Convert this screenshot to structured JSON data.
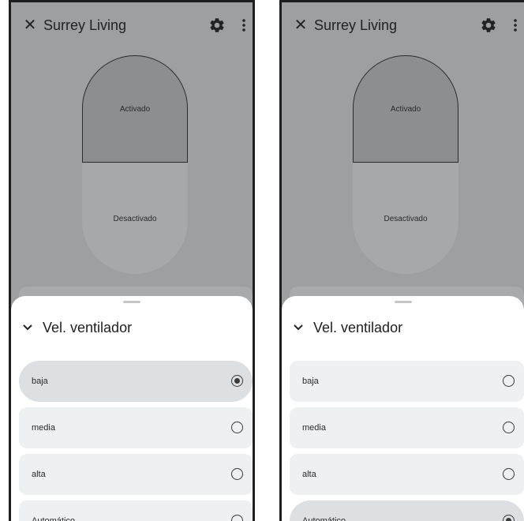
{
  "panels": [
    {
      "id": "left",
      "header": {
        "title": "Surrey Living"
      },
      "switch": {
        "on_label": "Activado",
        "off_label": "Desactivado"
      },
      "sheet": {
        "title": "Vel. ventilador"
      },
      "options": [
        {
          "label": "baja",
          "selected": true
        },
        {
          "label": "media",
          "selected": false
        },
        {
          "label": "alta",
          "selected": false
        },
        {
          "label": "Automático",
          "selected": false
        }
      ]
    },
    {
      "id": "right",
      "header": {
        "title": "Surrey Living"
      },
      "switch": {
        "on_label": "Activado",
        "off_label": "Desactivado"
      },
      "sheet": {
        "title": "Vel. ventilador"
      },
      "options": [
        {
          "label": "baja",
          "selected": false
        },
        {
          "label": "media",
          "selected": false
        },
        {
          "label": "alta",
          "selected": false
        },
        {
          "label": "Automático",
          "selected": true
        }
      ]
    }
  ],
  "icons": {
    "close": "close-icon",
    "settings": "gear-icon",
    "more": "more-vert-icon",
    "collapse": "chevron-down-icon"
  }
}
